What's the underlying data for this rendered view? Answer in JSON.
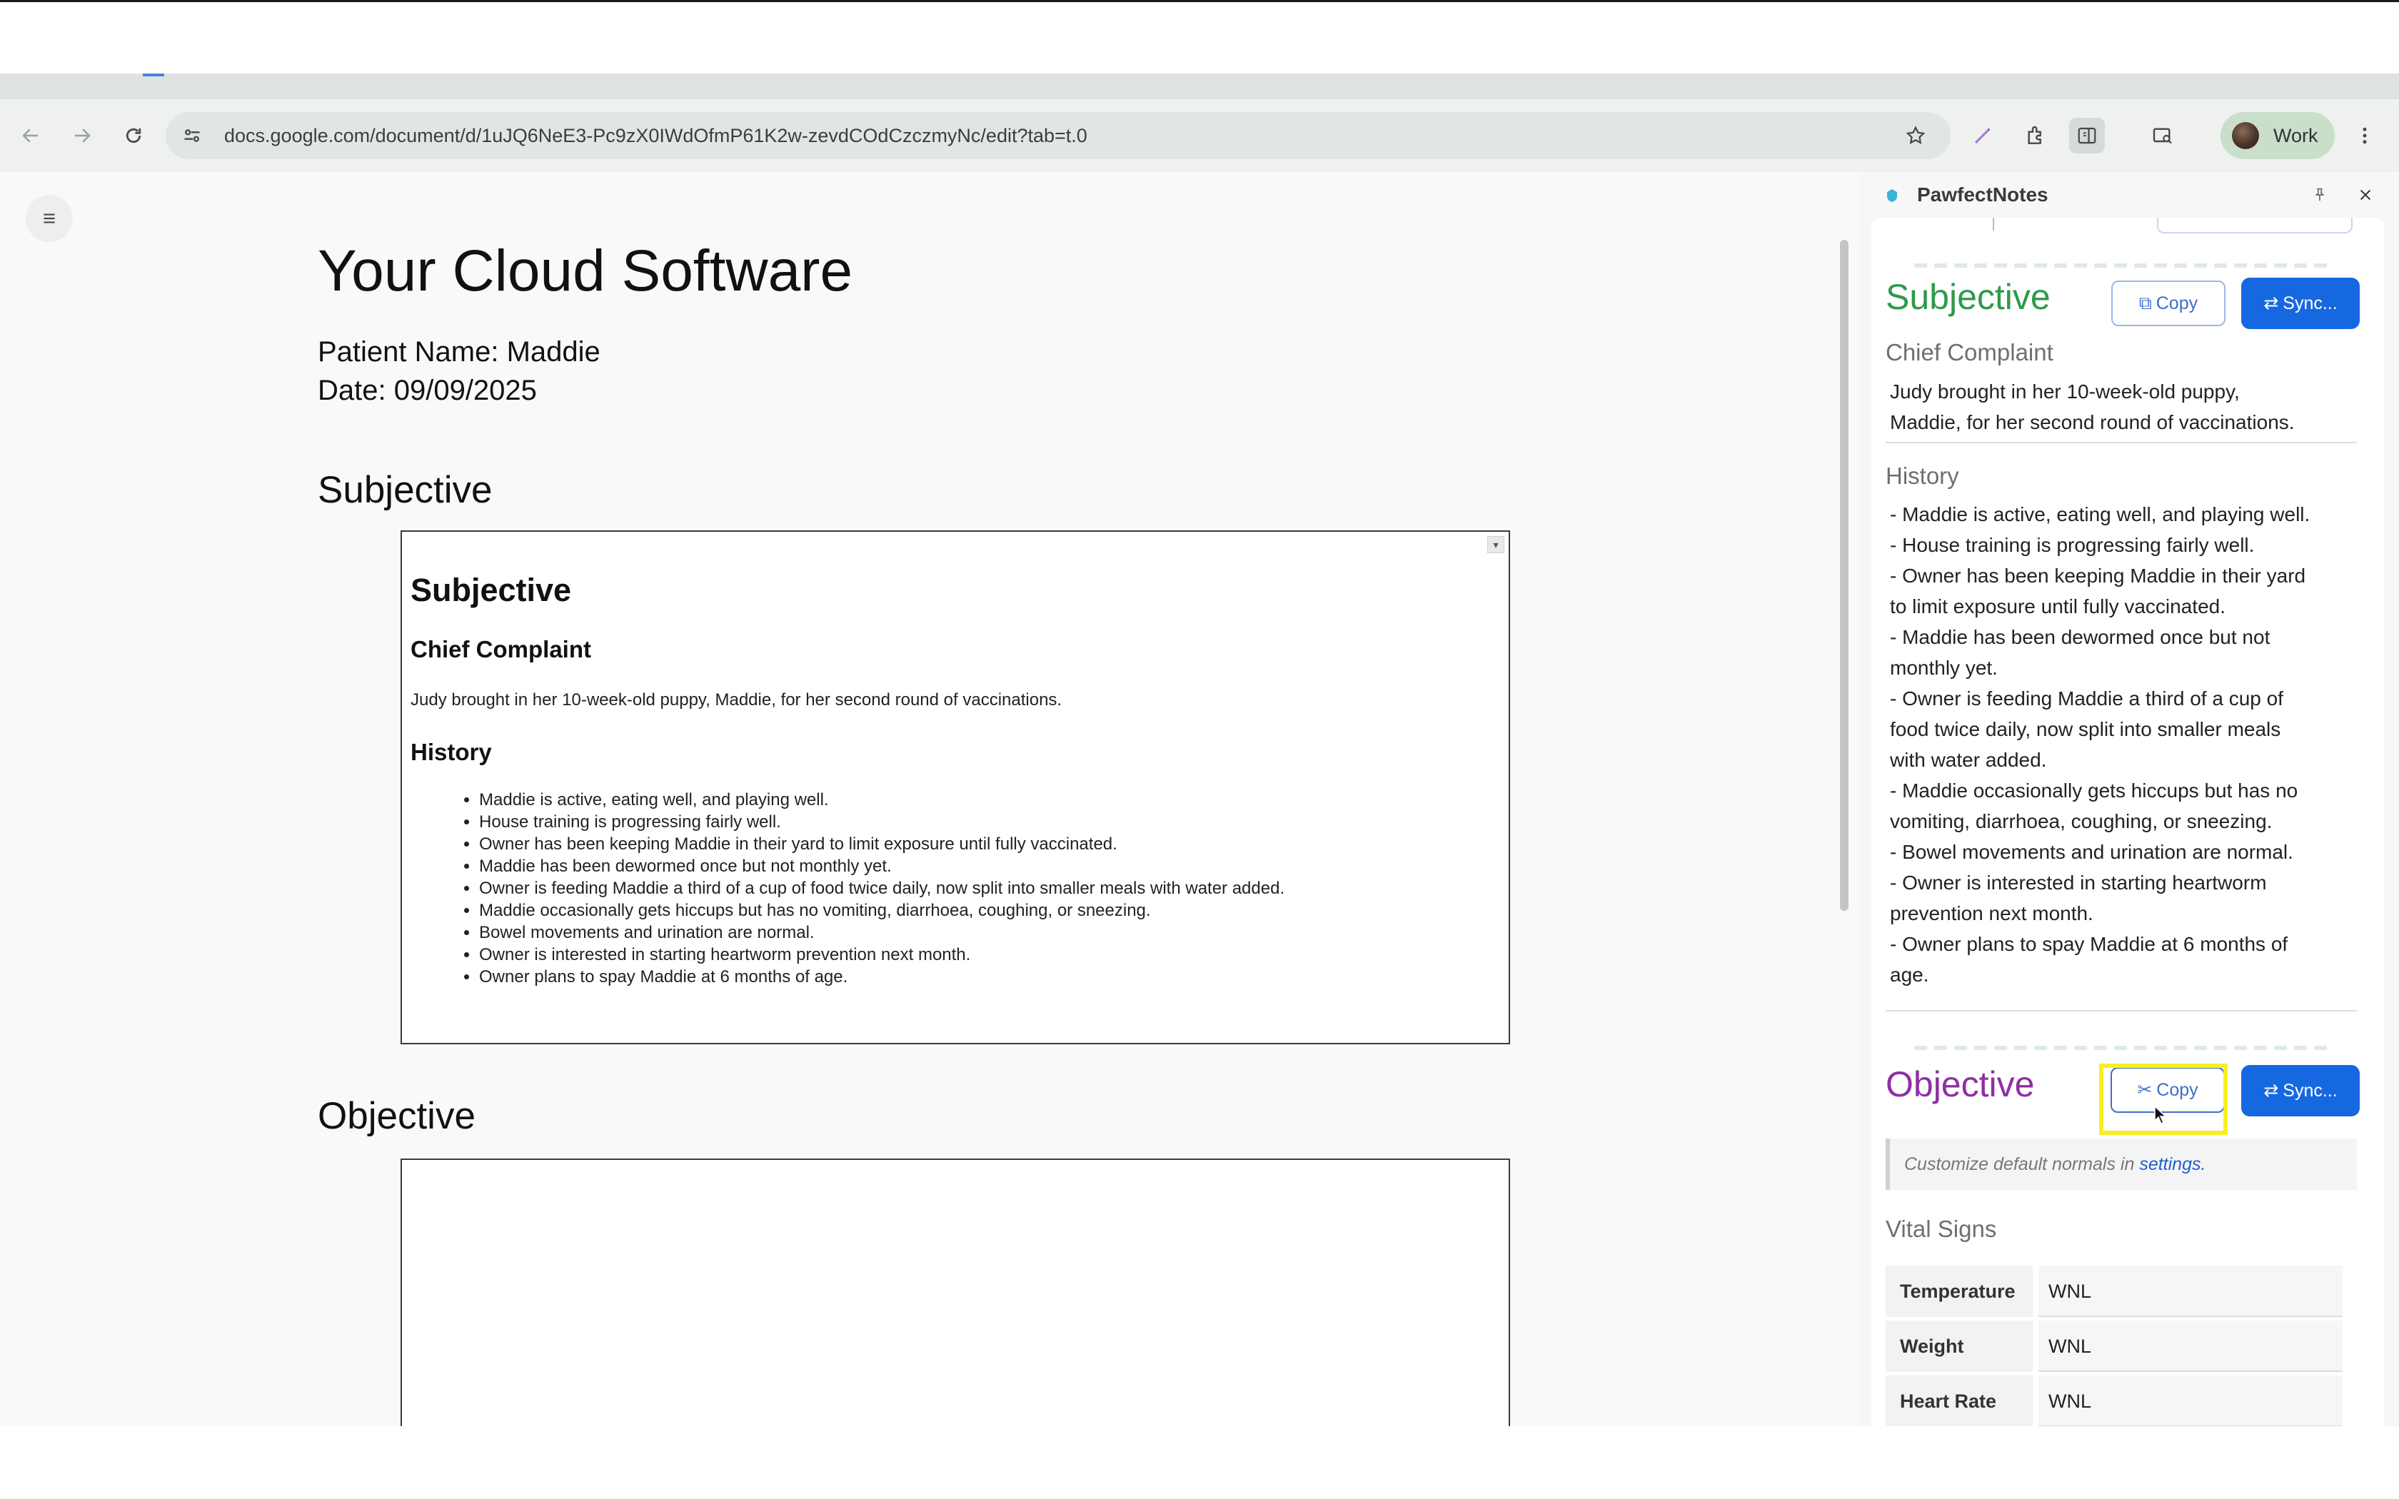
{
  "browser": {
    "url": "docs.google.com/document/d/1uJQ6NeE3-Pc9zX0IWdOfmP61K2w-zevdCOdCzczmyNc/edit?tab=t.0",
    "profile_label": "Work",
    "icons": [
      "back-icon",
      "forward-icon",
      "reload-icon",
      "site-info-icon",
      "star-icon",
      "pen-icon",
      "extensions-icon",
      "side-panel-icon",
      "tab-search-icon",
      "avatar",
      "more-icon"
    ]
  },
  "document": {
    "title": "Your Cloud Software",
    "patient_line": "Patient Name: Maddie",
    "date_line": "Date: 09/09/2025",
    "subjective_heading": "Subjective",
    "objective_heading": "Objective",
    "embed": {
      "title": "Subjective",
      "cc_heading": "Chief Complaint",
      "cc_text": "Judy brought in her 10-week-old puppy, Maddie, for her second round of vaccinations.",
      "history_heading": "History",
      "history_items": [
        "Maddie is active, eating well, and playing well.",
        "House training is progressing fairly well.",
        "Owner has been keeping Maddie in their yard to limit exposure until fully vaccinated.",
        "Maddie has been dewormed once but not monthly yet.",
        "Owner is feeding Maddie a third of a cup of food twice daily, now split into smaller meals with water added.",
        "Maddie occasionally gets hiccups but has no vomiting, diarrhoea, coughing, or sneezing.",
        "Bowel movements and urination are normal.",
        "Owner is interested in starting heartworm prevention next month.",
        "Owner plans to spay Maddie at 6 months of age."
      ]
    }
  },
  "panel": {
    "title": "PawfectNotes",
    "subjective": {
      "title": "Subjective",
      "title_color": "#2e9a4a",
      "copy_label": "Copy",
      "sync_label": "Sync...",
      "cc_label": "Chief Complaint",
      "cc_lines": [
        "Judy brought in her 10-week-old puppy,",
        "Maddie, for her second round of vaccinations."
      ],
      "history_label": "History",
      "history_lines": [
        "- Maddie is active, eating well, and playing well.",
        "- House training is progressing fairly well.",
        "- Owner has been keeping Maddie in their yard",
        "to limit exposure until fully vaccinated.",
        "- Maddie has been dewormed once but not",
        "monthly yet.",
        "- Owner is feeding Maddie a third of a cup of",
        "food twice daily, now split into smaller meals",
        "with water added.",
        "- Maddie occasionally gets hiccups but has no",
        "vomiting, diarrhoea, coughing, or sneezing.",
        "- Bowel movements and urination are normal.",
        "- Owner is interested in starting heartworm",
        "prevention next month.",
        "- Owner plans to spay Maddie at 6 months of",
        "age."
      ]
    },
    "objective": {
      "title": "Objective",
      "title_color": "#8e2fa3",
      "copy_label": "Copy",
      "sync_label": "Sync...",
      "hint_text": "Customize default normals in ",
      "hint_link": "settings.",
      "vitals_label": "Vital Signs",
      "vitals": [
        {
          "label": "Temperature",
          "value": "WNL"
        },
        {
          "label": "Weight",
          "value": "WNL"
        },
        {
          "label": "Heart Rate",
          "value": "WNL"
        }
      ]
    }
  }
}
